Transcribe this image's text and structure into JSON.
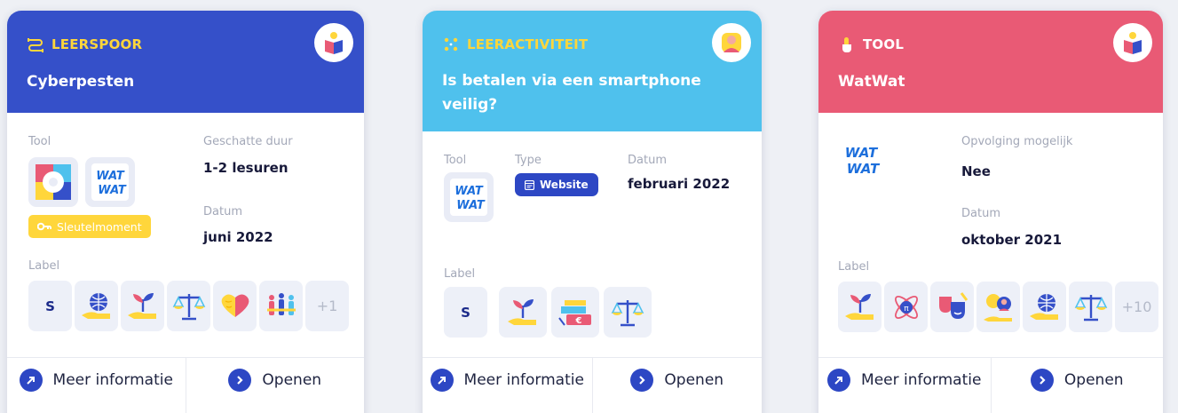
{
  "cards": [
    {
      "kind": "LEERSPOOR",
      "title": "Cyberpesten",
      "tool_label": "Tool",
      "duration_label": "Geschatte duur",
      "duration_value": "1-2 lesuren",
      "date_label": "Datum",
      "date_value": "juni 2022",
      "key_badge": "Sleutelmoment",
      "tool_logo_text": [
        "WAT",
        "WAT"
      ],
      "label_label": "Label",
      "label_text": "S",
      "label_more": "+1",
      "more_info": "Meer informatie",
      "open": "Openen",
      "header_color": "#3550c9"
    },
    {
      "kind": "LEERACTIVITEIT",
      "title": "Is betalen via een smartphone veilig?",
      "tool_label": "Tool",
      "type_label": "Type",
      "type_value": "Website",
      "date_label": "Datum",
      "date_value": "februari 2022",
      "tool_logo_text": [
        "WAT",
        "WAT"
      ],
      "label_label": "Label",
      "label_text": "S",
      "more_info": "Meer informatie",
      "open": "Openen",
      "header_color": "#4fc1ed"
    },
    {
      "kind": "TOOL",
      "title": "WatWat",
      "follow_label": "Opvolging mogelijk",
      "follow_value": "Nee",
      "date_label": "Datum",
      "date_value": "oktober 2021",
      "tool_logo_text": [
        "WAT",
        "WAT"
      ],
      "label_label": "Label",
      "label_more": "+10",
      "more_info": "Meer informatie",
      "open": "Openen",
      "header_color": "#e95a75"
    }
  ],
  "colors": {
    "accent": "#2d47c4",
    "yellow": "#ffd63b"
  }
}
